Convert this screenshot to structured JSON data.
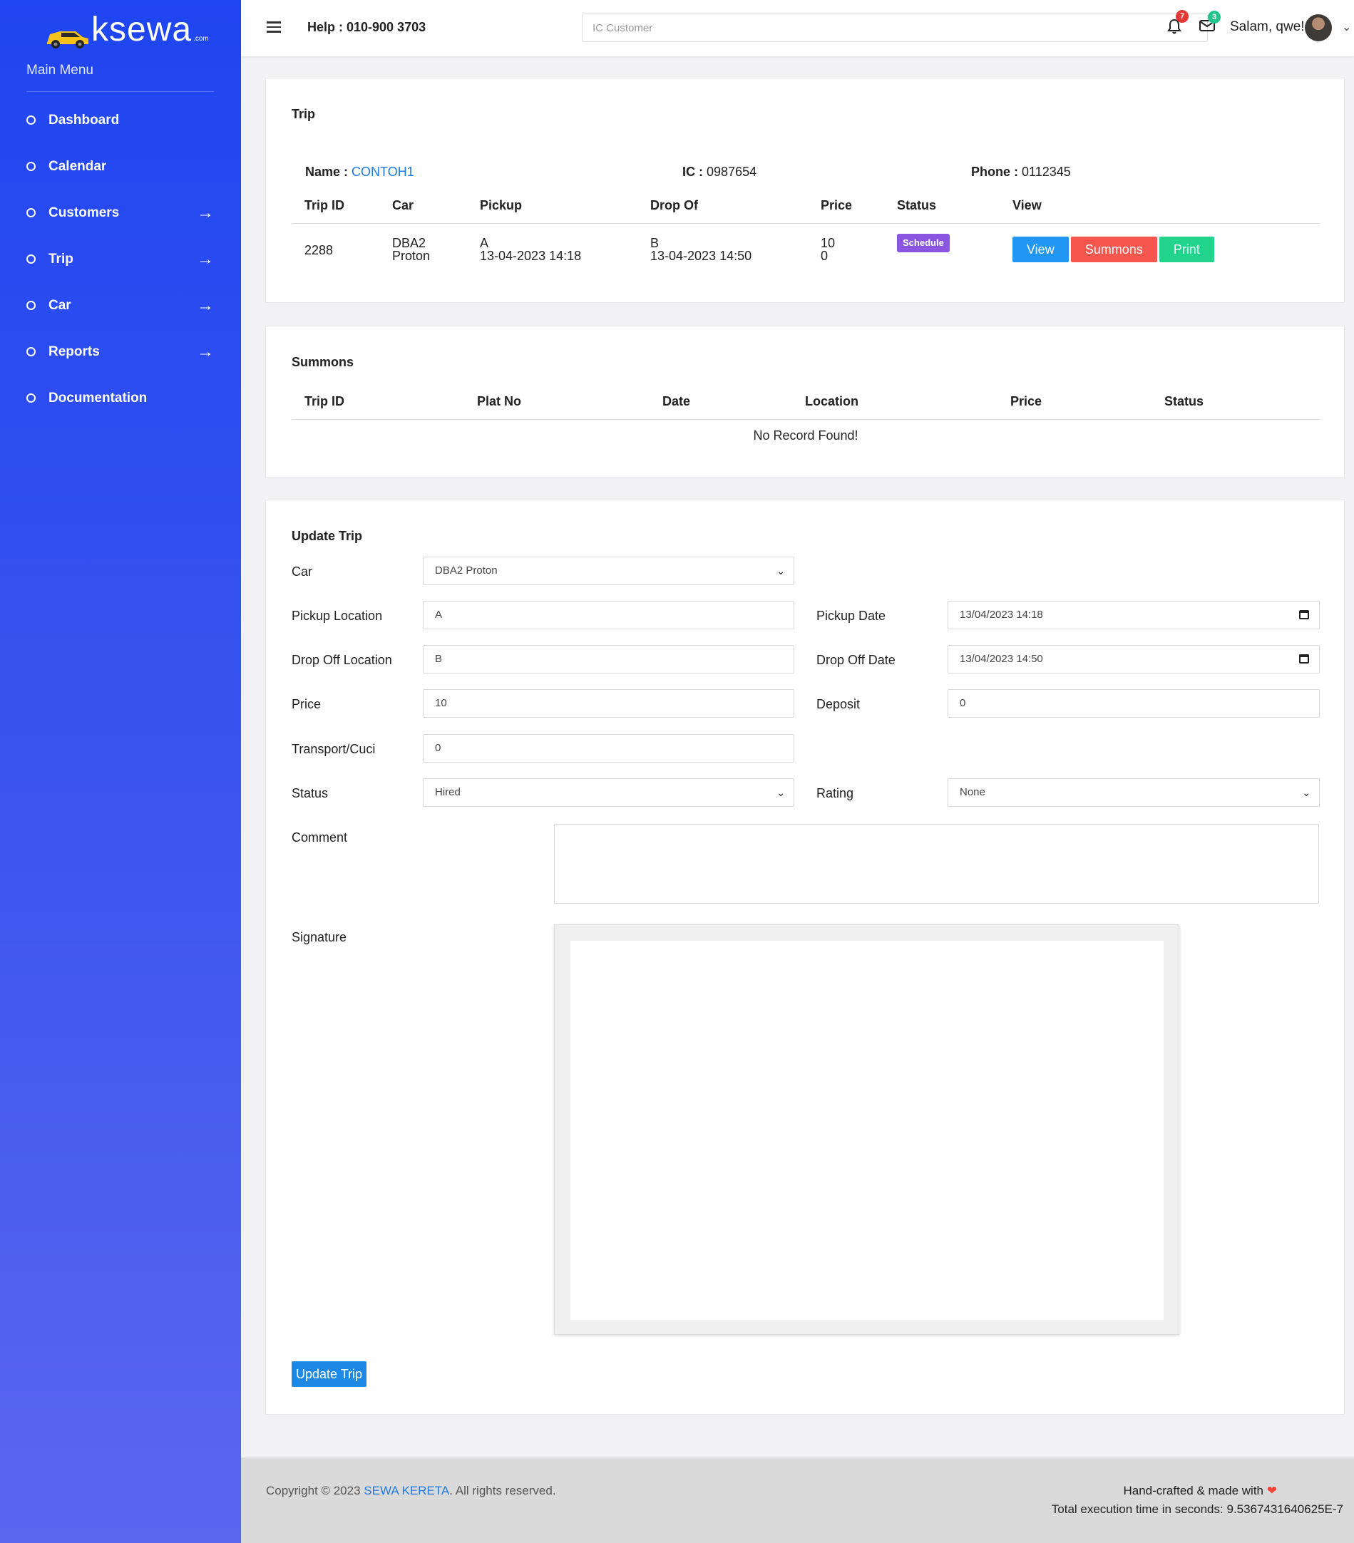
{
  "brand": {
    "name": "ksewa",
    "suffix": ".com"
  },
  "sidebar": {
    "title": "Main Menu",
    "items": [
      {
        "label": "Dashboard",
        "has_arrow": false
      },
      {
        "label": "Calendar",
        "has_arrow": false
      },
      {
        "label": "Customers",
        "has_arrow": true
      },
      {
        "label": "Trip",
        "has_arrow": true
      },
      {
        "label": "Car",
        "has_arrow": true
      },
      {
        "label": "Reports",
        "has_arrow": true
      },
      {
        "label": "Documentation",
        "has_arrow": false
      }
    ]
  },
  "topbar": {
    "help": "Help : 010-900 3703",
    "search_placeholder": "IC Customer",
    "notifications_count": "7",
    "messages_count": "3",
    "greeting": "Salam, qwe!"
  },
  "trip": {
    "title": "Trip",
    "name_label": "Name :",
    "name_value": "CONTOH1",
    "ic_label": "IC :",
    "ic_value": "0987654",
    "phone_label": "Phone :",
    "phone_value": "0112345",
    "columns": [
      "Trip ID",
      "Car",
      "Pickup",
      "Drop Of",
      "Price",
      "Status",
      "View"
    ],
    "row": {
      "trip_id": "2288",
      "car_line1": "DBA2",
      "car_line2": "Proton",
      "pickup_line1": "A",
      "pickup_line2": "13-04-2023 14:18",
      "drop_line1": "B",
      "drop_line2": "13-04-2023 14:50",
      "price_line1": "10",
      "price_line2": "0",
      "status": "Schedule",
      "btn_view": "View",
      "btn_summons": "Summons",
      "btn_print": "Print"
    }
  },
  "summons": {
    "title": "Summons",
    "columns": [
      "Trip ID",
      "Plat No",
      "Date",
      "Location",
      "Price",
      "Status"
    ],
    "empty": "No Record Found!"
  },
  "update": {
    "title": "Update Trip",
    "car_label": "Car",
    "car_value": "DBA2 Proton",
    "pickup_location_label": "Pickup Location",
    "pickup_location_value": "A",
    "pickup_date_label": "Pickup Date",
    "pickup_date_value": "13/04/2023 14:18",
    "dropoff_location_label": "Drop Off Location",
    "dropoff_location_value": "B",
    "dropoff_date_label": "Drop Off Date",
    "dropoff_date_value": "13/04/2023 14:50",
    "price_label": "Price",
    "price_value": "10",
    "deposit_label": "Deposit",
    "deposit_value": "0",
    "transport_label": "Transport/Cuci",
    "transport_value": "0",
    "status_label": "Status",
    "status_value": "Hired",
    "rating_label": "Rating",
    "rating_value": "None",
    "comment_label": "Comment",
    "signature_label": "Signature",
    "submit_label": "Update Trip"
  },
  "footer": {
    "copyright_prefix": "Copyright © 2023 ",
    "copyright_link": "SEWA KERETA",
    "copyright_suffix": ". All rights reserved.",
    "crafted": "Hand-crafted & made with",
    "exec": "Total execution time in seconds: 9.5367431640625E-7"
  },
  "colors": {
    "sidebar_top": "#1f45f0",
    "sidebar_bottom": "#5b67ef",
    "link": "#1f7ae0",
    "status_badge": "#8a55e0",
    "btn_view": "#2196f3",
    "btn_summons": "#f5574e",
    "btn_print": "#22d38b"
  }
}
